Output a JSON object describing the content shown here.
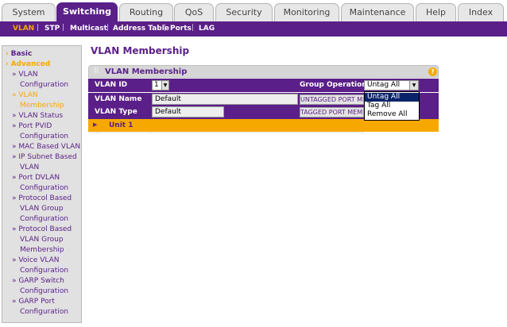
{
  "tabs": [
    {
      "label": "System"
    },
    {
      "label": "Switching"
    },
    {
      "label": "Routing"
    },
    {
      "label": "QoS"
    },
    {
      "label": "Security"
    },
    {
      "label": "Monitoring"
    },
    {
      "label": "Maintenance"
    },
    {
      "label": "Help"
    },
    {
      "label": "Index"
    }
  ],
  "active_tab": "Switching",
  "subnav": {
    "items": [
      "VLAN",
      "STP",
      "Multicast",
      "Address Table",
      "Ports",
      "LAG"
    ],
    "active": "VLAN",
    "separator": "|"
  },
  "sidebar": {
    "basic": "Basic",
    "advanced": "Advanced",
    "arrow": "›",
    "items": [
      {
        "line1": "VLAN",
        "line2": "Configuration"
      },
      {
        "line1": "VLAN",
        "line2": "Membership"
      },
      {
        "line1": "VLAN Status"
      },
      {
        "line1": "Port PVID",
        "line2": "Configuration"
      },
      {
        "line1": "MAC Based VLAN"
      },
      {
        "line1": "IP Subnet Based",
        "line2": "VLAN"
      },
      {
        "line1": "Port DVLAN",
        "line2": "Configuration"
      },
      {
        "line1": "Protocol Based",
        "line2": "VLAN Group",
        "line3": "Configuration"
      },
      {
        "line1": "Protocol Based",
        "line2": "VLAN Group",
        "line3": "Membership"
      },
      {
        "line1": "Voice VLAN",
        "line2": "Configuration"
      },
      {
        "line1": "GARP Switch",
        "line2": "Configuration"
      },
      {
        "line1": "GARP Port",
        "line2": "Configuration"
      }
    ],
    "bullet": "»"
  },
  "main": {
    "page_title": "VLAN Membership",
    "panel_title": "VLAN Membership",
    "help_icon_glyph": "?",
    "vlan_id_label": "VLAN ID",
    "vlan_id_value": "1",
    "group_operation_label": "Group Operation",
    "group_operation_value": "Untag All",
    "vlan_name_label": "VLAN Name",
    "vlan_name_value": "Default",
    "vlan_type_label": "VLAN Type",
    "vlan_type_value": "Default",
    "untagged_button": "UNTAGGED PORT MEMBERS",
    "tagged_button": "TAGGED PORT MEMBERS",
    "unit_label": "Unit 1"
  },
  "dropdown": {
    "options": [
      "Untag All",
      "Tag All",
      "Remove All"
    ],
    "selected": "Untag All"
  },
  "colors": {
    "brand_purple": "#5a1f88",
    "accent_orange": "#f7a800",
    "selection_blue": "#0a246a"
  }
}
